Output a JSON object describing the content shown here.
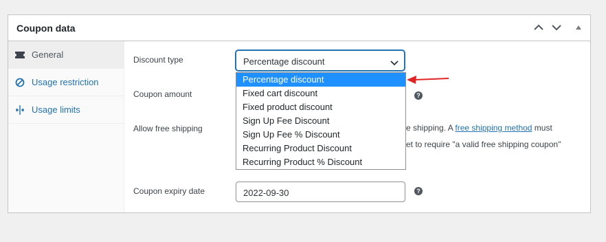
{
  "panel": {
    "title": "Coupon data"
  },
  "tabs": [
    {
      "label": "General",
      "icon": "ticket-icon",
      "active": true
    },
    {
      "label": "Usage restriction",
      "icon": "block-icon",
      "active": false
    },
    {
      "label": "Usage limits",
      "icon": "limits-icon",
      "active": false
    }
  ],
  "fields": {
    "discount_type_label": "Discount type",
    "discount_type_value": "Percentage discount",
    "coupon_amount_label": "Coupon amount",
    "allow_free_shipping_label": "Allow free shipping",
    "free_shipping_text_pre": "e shipping. A ",
    "free_shipping_link": "free shipping method",
    "free_shipping_text_post": " must",
    "free_shipping_text_line2": "et to require \"a valid free shipping coupon\"",
    "coupon_expiry_label": "Coupon expiry date",
    "coupon_expiry_value": "2022-09-30"
  },
  "dropdown_options": [
    "Percentage discount",
    "Fixed cart discount",
    "Fixed product discount",
    "Sign Up Fee Discount",
    "Sign Up Fee % Discount",
    "Recurring Product Discount",
    "Recurring Product % Discount"
  ],
  "help_glyph": "?",
  "colors": {
    "accent": "#2271b1",
    "selected_option": "#1e90ff",
    "annotation_arrow": "#e02424"
  }
}
